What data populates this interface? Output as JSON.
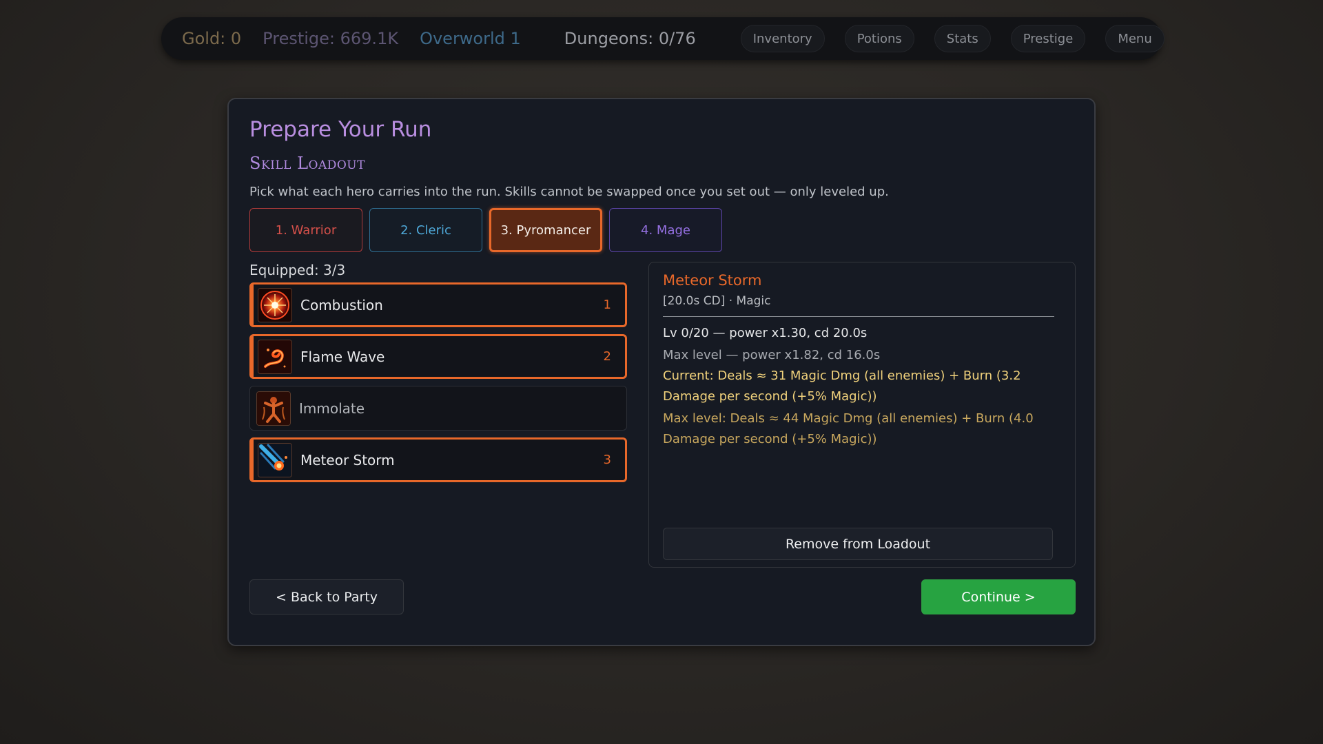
{
  "topbar": {
    "gold": "Gold: 0",
    "prestige": "Prestige: 669.1K",
    "world": "Overworld 1",
    "dungeons": "Dungeons: 0/76",
    "nav": [
      "Inventory",
      "Potions",
      "Stats",
      "Prestige",
      "Menu"
    ]
  },
  "panel": {
    "title": "Prepare Your Run",
    "subtitle": "Skill Loadout",
    "description": "Pick what each hero carries into the run. Skills cannot be swapped once you set out — only leveled up.",
    "heroes": [
      "1. Warrior",
      "2. Cleric",
      "3. Pyromancer",
      "4. Mage"
    ],
    "selected_hero": "3. Pyromancer",
    "equipped": "Equipped: 3/3",
    "skills": [
      {
        "name": "Combustion",
        "slot": "1",
        "equipped": true,
        "icon": "combustion-icon"
      },
      {
        "name": "Flame Wave",
        "slot": "2",
        "equipped": true,
        "icon": "flame-wave-icon"
      },
      {
        "name": "Immolate",
        "slot": "",
        "equipped": false,
        "icon": "immolate-icon"
      },
      {
        "name": "Meteor Storm",
        "slot": "3",
        "equipped": true,
        "icon": "meteor-storm-icon"
      }
    ],
    "detail": {
      "name": "Meteor Storm",
      "sub": "[20.0s CD] · Magic",
      "level": "Lv 0/20 — power x1.30, cd 20.0s",
      "max_level": "Max level — power x1.82, cd 16.0s",
      "current": "Current: Deals ≈ 31 Magic Dmg (all enemies) + Burn (3.2 Damage per second (+5% Magic))",
      "max": "Max level: Deals ≈ 44 Magic Dmg (all enemies) + Burn (4.0 Damage per second (+5% Magic))",
      "remove": "Remove from Loadout"
    },
    "back": "< Back to Party",
    "continue": "Continue >"
  },
  "colors": {
    "accent": "#e8682a",
    "title": "#b98ee0",
    "continue": "#27a341",
    "current_text": "#f1d27c",
    "max_text": "#c9a85e"
  }
}
